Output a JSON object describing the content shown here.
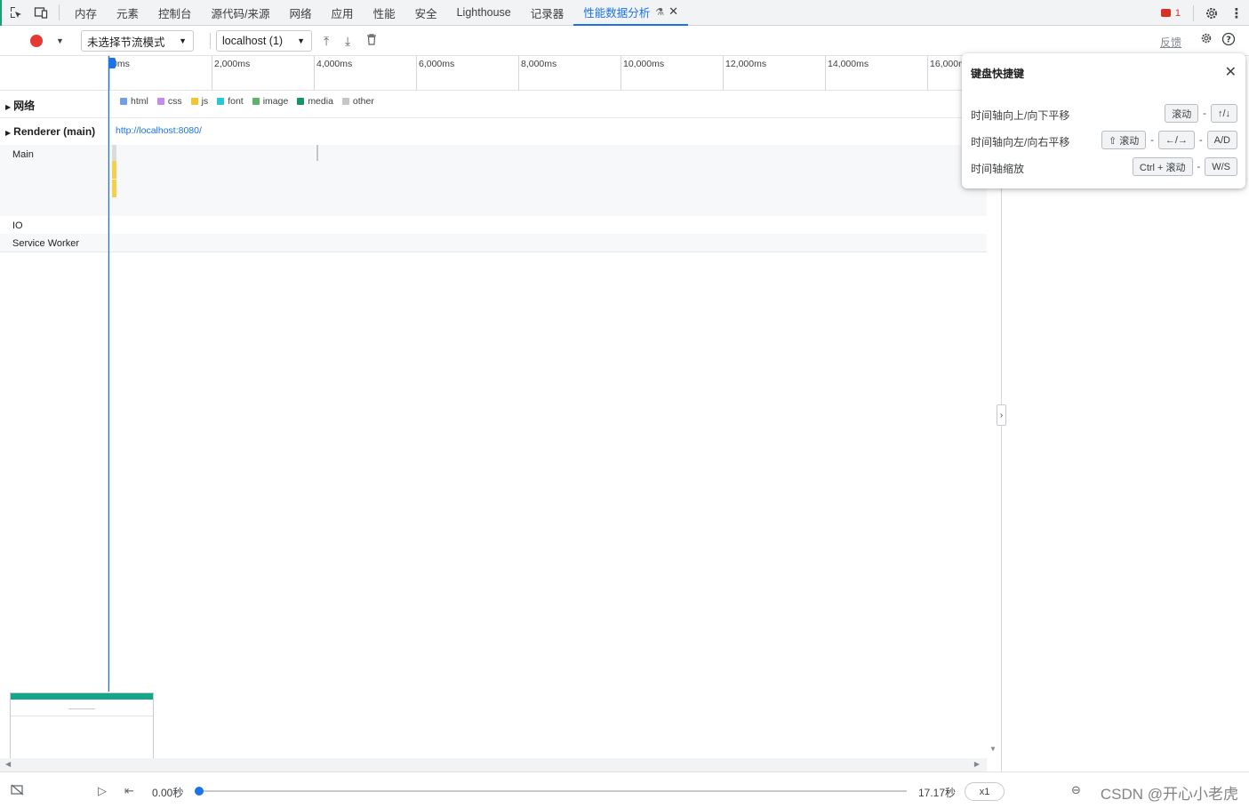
{
  "tabs": [
    {
      "label": "内存"
    },
    {
      "label": "元素"
    },
    {
      "label": "控制台"
    },
    {
      "label": "源代码/来源"
    },
    {
      "label": "网络"
    },
    {
      "label": "应用"
    },
    {
      "label": "性能"
    },
    {
      "label": "安全"
    },
    {
      "label": "Lighthouse"
    },
    {
      "label": "记录器"
    },
    {
      "label": "性能数据分析"
    }
  ],
  "issues_count": "1",
  "toolbar": {
    "throttle_select": "未选择节流模式",
    "profile_select": "localhost (1)",
    "feedback_label": "反馈"
  },
  "ruler_ticks": [
    "0ms",
    "2,000ms",
    "4,000ms",
    "6,000ms",
    "8,000ms",
    "10,000ms",
    "12,000ms",
    "14,000ms",
    "16,000ms"
  ],
  "tracks": {
    "network": "网络",
    "renderer": "Renderer (main)",
    "main": "Main",
    "io": "IO",
    "service_worker": "Service Worker"
  },
  "legend": [
    {
      "label": "html",
      "color": "#6e9fe8"
    },
    {
      "label": "css",
      "color": "#c58af0"
    },
    {
      "label": "js",
      "color": "#f4c430"
    },
    {
      "label": "font",
      "color": "#28c8d8"
    },
    {
      "label": "image",
      "color": "#5cb46c"
    },
    {
      "label": "media",
      "color": "#16936b"
    },
    {
      "label": "other",
      "color": "#c4c6c9"
    }
  ],
  "renderer_url": "http://localhost:8080/",
  "shortcuts_dialog": {
    "title": "键盘快捷键",
    "rows": [
      {
        "name": "时间轴向上/向下平移",
        "keys": [
          "滚动",
          "↑/↓"
        ]
      },
      {
        "name": "时间轴向左/向右平移",
        "keys": [
          "⇧ 滚动",
          "←/→",
          "A/D"
        ]
      },
      {
        "name": "时间轴缩放",
        "keys": [
          "Ctrl + 滚动",
          "W/S"
        ]
      }
    ]
  },
  "bottom": {
    "current_time": "0.00秒",
    "total_time": "17.17秒",
    "speed": "x1",
    "playback_progress": 0
  },
  "watermark": "CSDN @开心小老虎",
  "colors": {
    "accent": "#1a73e8",
    "record": "#e53935"
  }
}
